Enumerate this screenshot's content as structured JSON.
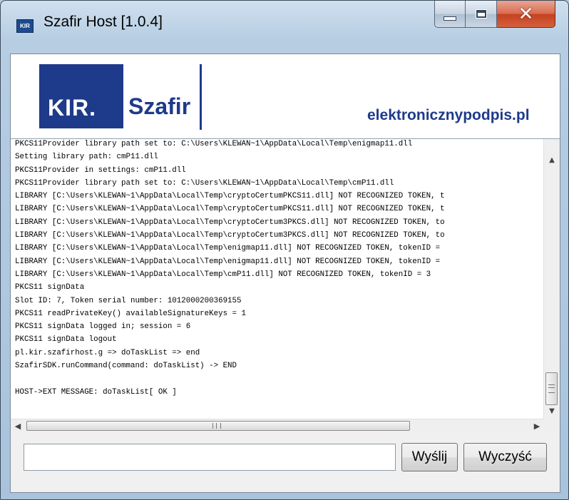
{
  "window": {
    "title": "Szafir Host [1.0.4]",
    "app_icon_text": "KIR"
  },
  "banner": {
    "kir_label": "KIR.",
    "szafir_label": "Szafir",
    "site": "elektronicznypodpis.pl",
    "brand_color": "#1e3a8a"
  },
  "log": {
    "lines": [
      "PKCS11Provider library path set to: C:\\Users\\KLEWAN~1\\AppData\\Local\\Temp\\enigmap11.dll",
      "Setting library path: cmP11.dll",
      "PKCS11Provider in settings: cmP11.dll",
      "PKCS11Provider library path set to: C:\\Users\\KLEWAN~1\\AppData\\Local\\Temp\\cmP11.dll",
      "LIBRARY [C:\\Users\\KLEWAN~1\\AppData\\Local\\Temp\\cryptoCertumPKCS11.dll] NOT RECOGNIZED TOKEN, t",
      "LIBRARY [C:\\Users\\KLEWAN~1\\AppData\\Local\\Temp\\cryptoCertumPKCS11.dll] NOT RECOGNIZED TOKEN, t",
      "LIBRARY [C:\\Users\\KLEWAN~1\\AppData\\Local\\Temp\\cryptoCertum3PKCS.dll] NOT RECOGNIZED TOKEN, to",
      "LIBRARY [C:\\Users\\KLEWAN~1\\AppData\\Local\\Temp\\cryptoCertum3PKCS.dll] NOT RECOGNIZED TOKEN, to",
      "LIBRARY [C:\\Users\\KLEWAN~1\\AppData\\Local\\Temp\\enigmap11.dll] NOT RECOGNIZED TOKEN, tokenID =",
      "LIBRARY [C:\\Users\\KLEWAN~1\\AppData\\Local\\Temp\\enigmap11.dll] NOT RECOGNIZED TOKEN, tokenID =",
      "LIBRARY [C:\\Users\\KLEWAN~1\\AppData\\Local\\Temp\\cmP11.dll] NOT RECOGNIZED TOKEN, tokenID = 3",
      "PKCS11 signData",
      "Slot ID: 7, Token serial number: 1012000200369155",
      "PKCS11 readPrivateKey() availableSignatureKeys = 1",
      "PKCS11 signData logged in; session = 6",
      "PKCS11 signData logout",
      "pl.kir.szafirhost.g => doTaskList => end",
      "SzafirSDK.runCommand(command: doTaskList) -> END",
      "",
      "HOST->EXT MESSAGE: doTaskList[ OK ]"
    ]
  },
  "scroll": {
    "up_icon": "▲",
    "down_icon": "▼",
    "left_icon": "◀",
    "right_icon": "▶"
  },
  "controls": {
    "input_value": "",
    "send_label": "Wyślij",
    "clear_label": "Wyczyść"
  }
}
